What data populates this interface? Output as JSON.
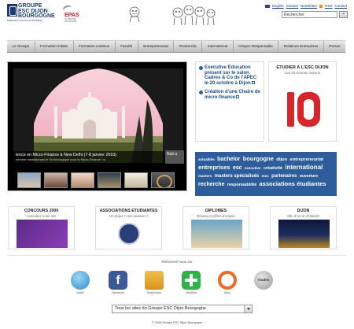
{
  "header": {
    "logo_line1": "GROUPE",
    "logo_line2": "ESC DIJON",
    "logo_line3": "BOURGOGNE",
    "logo_sub": "BURGUNDY SCHOOL OF BUSINESS",
    "epas_title": "EPAS",
    "epas_sub": "ACCREDITED PROGRAMME",
    "top_links": [
      "English",
      "Intranet",
      "Newsletter",
      "RSS",
      "Contact"
    ],
    "search_value": "Rechercher",
    "search_button": ">"
  },
  "nav": {
    "items": [
      "Le Groupe",
      "Formation initiale",
      "Formation continue",
      "Faculté",
      "Entrepreneuriat",
      "Recherche",
      "International",
      "Citoyen Responsable",
      "Relations Entreprises",
      "Presse"
    ]
  },
  "slideshow": {
    "caption_title": "ience en Micro-Finance à New Delhi (7-8 janvier 2010)",
    "caption_sub": "nement Institutionnel et Technologique pour la Micro-Finance\" m",
    "next_title": "Nuit a"
  },
  "news": [
    "Executive Education présent sur le salon Cadres & Co de l'APEC le 20 octobre à Dijon",
    "Création d'une Chaire de micro-finance"
  ],
  "etudier": {
    "title": "ETUDIER A L'ESC DIJON",
    "subtitle": "Les 10 bonnes raisons"
  },
  "tags": [
    {
      "text": "actualités",
      "size": 4.5
    },
    {
      "text": "bachelor",
      "size": 7
    },
    {
      "text": "bourgogne",
      "size": 7.5
    },
    {
      "text": "dijon",
      "size": 5.8
    },
    {
      "text": "entrepreneuriat",
      "size": 5.8
    },
    {
      "text": "entreprises",
      "size": 7.5
    },
    {
      "text": "esc",
      "size": 7
    },
    {
      "text": "executive",
      "size": 4.5
    },
    {
      "text": "créativité",
      "size": 5.5
    },
    {
      "text": "international",
      "size": 8
    },
    {
      "text": "masters",
      "size": 4.5
    },
    {
      "text": "masters spécialisés",
      "size": 6
    },
    {
      "text": "msc",
      "size": 4.5
    },
    {
      "text": "partenaires",
      "size": 6
    },
    {
      "text": "ouverture",
      "size": 5
    },
    {
      "text": "recherche",
      "size": 7
    },
    {
      "text": "responsabilité",
      "size": 5.5
    },
    {
      "text": "associations étudiantes",
      "size": 7.5
    }
  ],
  "boxes": [
    {
      "title": "CONCOURS 2009",
      "sub": "Consultez notre site"
    },
    {
      "title": "ASSOCIATIONS ETUDIANTES",
      "sub": "Un projet ? Une passion ?"
    },
    {
      "title": "DIPLOMES",
      "sub": "Réseau et offres d'emploi"
    },
    {
      "title": "DIJON",
      "sub": "Ville d'Art et d'Histoire"
    }
  ],
  "retrouvez": "Retrouvez-nous sur",
  "social": [
    {
      "label": "twitter",
      "icon": "twitter-icon"
    },
    {
      "label": "Facebook",
      "icon": "facebook-icon"
    },
    {
      "label": "Dailymotion",
      "icon": "dailymotion-icon"
    },
    {
      "label": "Netvibes",
      "icon": "netvibes-icon"
    },
    {
      "label": "issuu",
      "icon": "issuu-icon"
    },
    {
      "label": "",
      "icon": "viadeo-icon",
      "text": "Viadeo"
    }
  ],
  "site_select": "Tous les sites du Groupe ESC Dijon Bourgogne",
  "copyright": "© 2009 Groupe ESC Dijon Bourgogne",
  "colors": {
    "brand_blue": "#1b3a7a",
    "tag_cloud_bg": "#2d5d9b",
    "epas_red": "#c0172b",
    "ten_red": "#d7262b"
  }
}
